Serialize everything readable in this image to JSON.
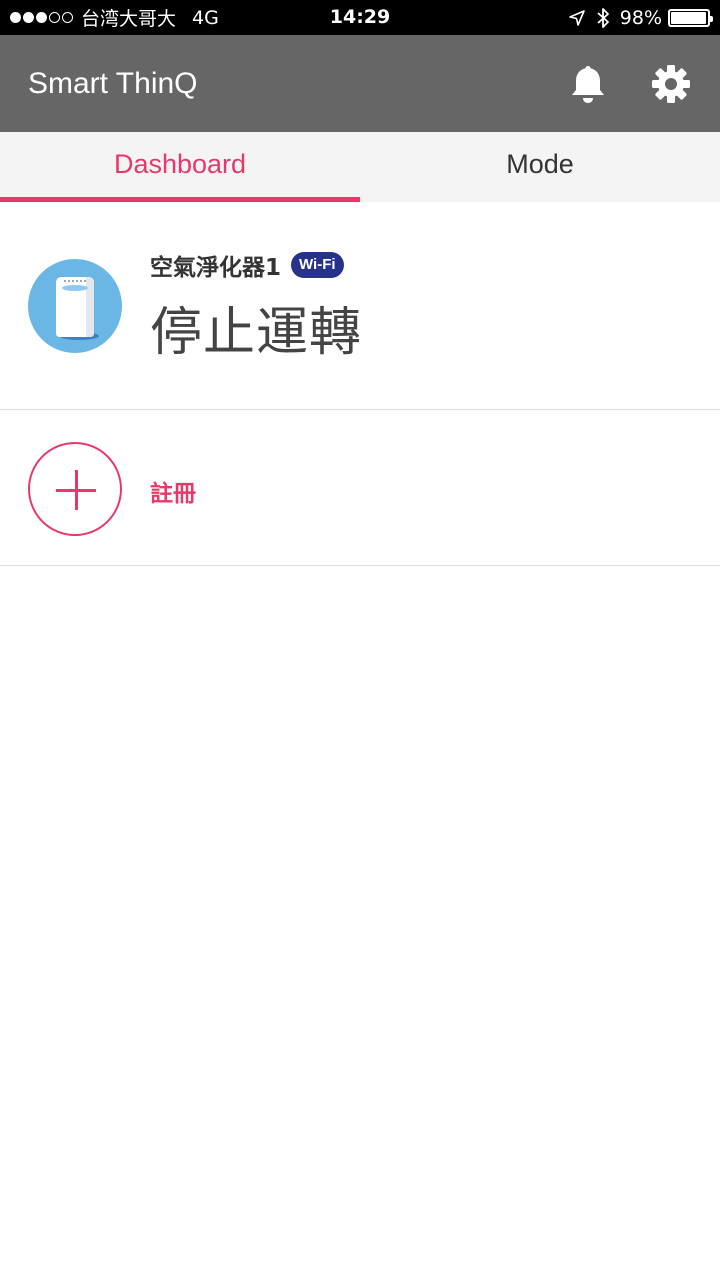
{
  "status_bar": {
    "carrier": "台湾大哥大",
    "network": "4G",
    "time": "14:29",
    "battery_text": "98%",
    "battery_level": 0.98,
    "signal_bars_full": 3,
    "signal_bars_total": 5
  },
  "header": {
    "title": "Smart ThinQ",
    "icons": [
      "bell-icon",
      "gear-icon"
    ]
  },
  "tabs": [
    {
      "label": "Dashboard",
      "active": true
    },
    {
      "label": "Mode",
      "active": false
    }
  ],
  "devices": [
    {
      "name": "空氣淨化器1",
      "connection_badge": "Wi-Fi",
      "status": "停止運轉",
      "icon": "air-purifier-icon"
    }
  ],
  "register": {
    "label": "註冊",
    "icon": "plus-icon"
  },
  "colors": {
    "accent": "#e8386a",
    "header_bg": "#666666",
    "badge_bg": "#27338a",
    "device_icon_bg": "#6ab7e6"
  }
}
